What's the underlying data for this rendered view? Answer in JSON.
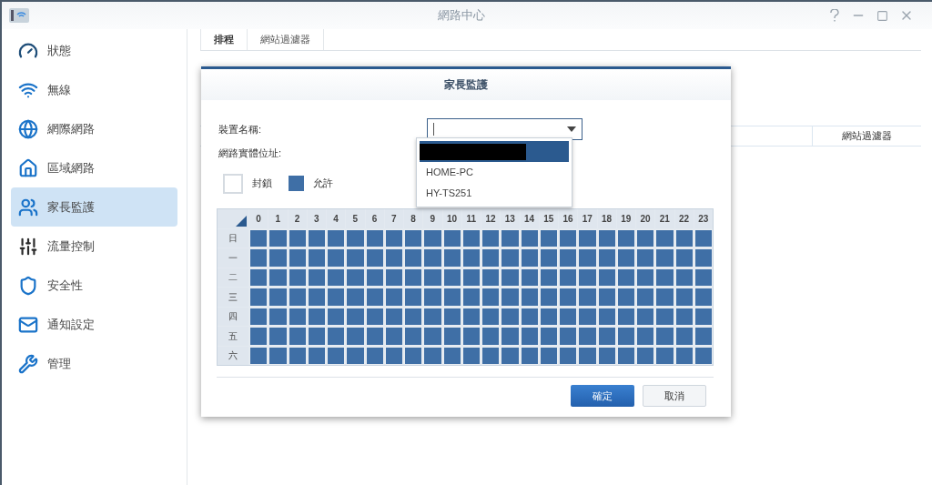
{
  "window": {
    "title": "網路中心"
  },
  "sidebar": {
    "items": [
      {
        "label": "狀態",
        "selected": false
      },
      {
        "label": "無線",
        "selected": false
      },
      {
        "label": "網際網路",
        "selected": false
      },
      {
        "label": "區域網路",
        "selected": false
      },
      {
        "label": "家長監護",
        "selected": true
      },
      {
        "label": "流量控制",
        "selected": false
      },
      {
        "label": "安全性",
        "selected": false
      },
      {
        "label": "通知設定",
        "selected": false
      },
      {
        "label": "管理",
        "selected": false
      }
    ]
  },
  "tabs": [
    {
      "label": "排程",
      "selected": true
    },
    {
      "label": "網站過濾器",
      "selected": false
    }
  ],
  "table": {
    "columns": [
      "網站過濾器"
    ]
  },
  "dialog": {
    "title": "家長監護",
    "device_label": "裝置名稱:",
    "mac_label": "網路實體位址:",
    "dropdown": {
      "items": [
        {
          "kind": "redacted",
          "selected": true
        },
        {
          "kind": "text",
          "label": "HOME-PC",
          "selected": false
        },
        {
          "kind": "text",
          "label": "HY-TS251",
          "selected": false
        }
      ]
    },
    "legend": [
      {
        "label": "封鎖",
        "allowed": false
      },
      {
        "label": "允許",
        "allowed": true
      }
    ],
    "schedule": {
      "hours": [
        "0",
        "1",
        "2",
        "3",
        "4",
        "5",
        "6",
        "7",
        "8",
        "9",
        "10",
        "11",
        "12",
        "13",
        "14",
        "15",
        "16",
        "17",
        "18",
        "19",
        "20",
        "21",
        "22",
        "23"
      ],
      "rows": [
        {
          "day": "日",
          "allowed": [
            true,
            true,
            true,
            true,
            true,
            true,
            true,
            true,
            true,
            true,
            true,
            true,
            true,
            true,
            true,
            true,
            true,
            true,
            true,
            true,
            true,
            true,
            true,
            true
          ]
        },
        {
          "day": "一",
          "allowed": [
            true,
            true,
            true,
            true,
            true,
            true,
            true,
            true,
            true,
            true,
            true,
            true,
            true,
            true,
            true,
            true,
            true,
            true,
            true,
            true,
            true,
            true,
            true,
            true
          ]
        },
        {
          "day": "二",
          "allowed": [
            true,
            true,
            true,
            true,
            true,
            true,
            true,
            true,
            true,
            true,
            true,
            true,
            true,
            true,
            true,
            true,
            true,
            true,
            true,
            true,
            true,
            true,
            true,
            true
          ]
        },
        {
          "day": "三",
          "allowed": [
            true,
            true,
            true,
            true,
            true,
            true,
            true,
            true,
            true,
            true,
            true,
            true,
            true,
            true,
            true,
            true,
            true,
            true,
            true,
            true,
            true,
            true,
            true,
            true
          ]
        },
        {
          "day": "四",
          "allowed": [
            true,
            true,
            true,
            true,
            true,
            true,
            true,
            true,
            true,
            true,
            true,
            true,
            true,
            true,
            true,
            true,
            true,
            true,
            true,
            true,
            true,
            true,
            true,
            true
          ]
        },
        {
          "day": "五",
          "allowed": [
            true,
            true,
            true,
            true,
            true,
            true,
            true,
            true,
            true,
            true,
            true,
            true,
            true,
            true,
            true,
            true,
            true,
            true,
            true,
            true,
            true,
            true,
            true,
            true
          ]
        },
        {
          "day": "六",
          "allowed": [
            true,
            true,
            true,
            true,
            true,
            true,
            true,
            true,
            true,
            true,
            true,
            true,
            true,
            true,
            true,
            true,
            true,
            true,
            true,
            true,
            true,
            true,
            true,
            true
          ]
        }
      ]
    },
    "buttons": [
      {
        "label": "確定",
        "kind": "primary"
      },
      {
        "label": "取消",
        "kind": "secondary"
      }
    ]
  }
}
